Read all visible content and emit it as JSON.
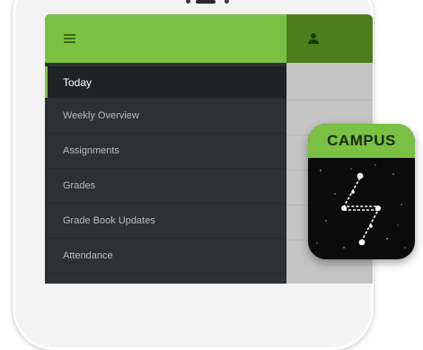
{
  "app": {
    "menu_icon": "hamburger-menu-icon",
    "user_icon": "user-profile-icon",
    "theme": {
      "accent": "#7ac143",
      "accent_dark": "#4c7f1c",
      "drawer_bg": "#2e3133",
      "drawer_active_bg": "#202325"
    }
  },
  "drawer": {
    "items": [
      {
        "label": "Today",
        "active": true
      },
      {
        "label": "Weekly Overview",
        "active": false
      },
      {
        "label": "Assignments",
        "active": false
      },
      {
        "label": "Grades",
        "active": false
      },
      {
        "label": "Grade Book Updates",
        "active": false
      },
      {
        "label": "Attendance",
        "active": false
      }
    ]
  },
  "app_icon": {
    "name": "CAMPUS",
    "icon": "constellation-logo-icon",
    "band_color": "#7ac143"
  }
}
